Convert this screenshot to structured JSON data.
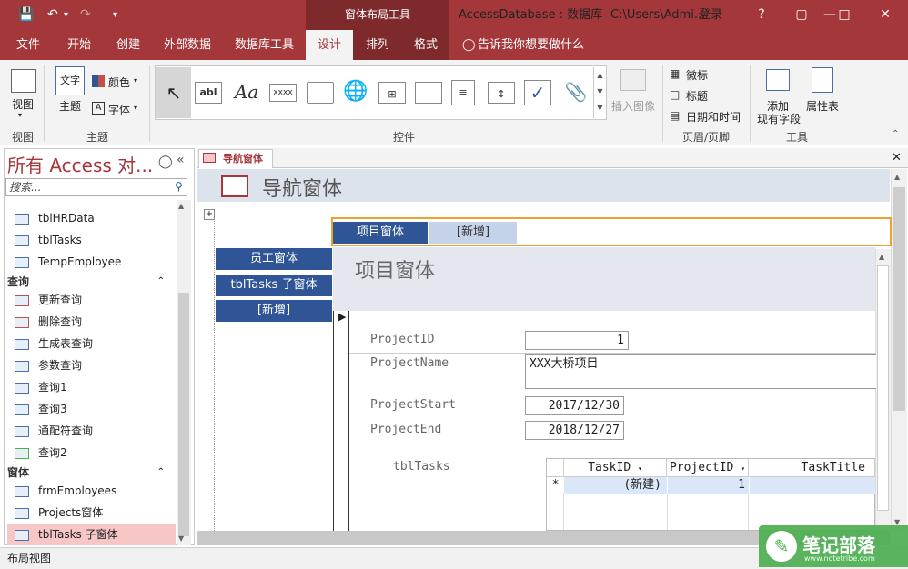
{
  "titlebar": {
    "context_tool": "窗体布局工具",
    "title": "AccessDatabase : 数据库- C:\\Users\\Admi...",
    "login": "登录",
    "help": "?"
  },
  "tabs": [
    "文件",
    "开始",
    "创建",
    "外部数据",
    "数据库工具",
    "设计",
    "排列",
    "格式"
  ],
  "tellme": "告诉我你想要做什么",
  "ribbon": {
    "view_label": "视图",
    "group_view": "视图",
    "theme_label": "主题",
    "colors_label": "颜色",
    "fonts_label": "字体",
    "group_theme": "主题",
    "group_controls": "控件",
    "insert_image": "插入图像",
    "logo": "徽标",
    "title": "标题",
    "datetime": "日期和时间",
    "group_header": "页眉/页脚",
    "add_fields": "添加",
    "add_fields2": "现有字段",
    "property_sheet": "属性表",
    "group_tools": "工具",
    "ctl_textbox": "abl",
    "ctl_label": "Aa",
    "ctl_button": "xxxx"
  },
  "nav": {
    "title": "所有 Access 对...",
    "search_placeholder": "搜索...",
    "tables": [
      "tblHRData",
      "tblTasks",
      "TempEmployee"
    ],
    "queries_header": "查询",
    "queries": [
      "更新查询",
      "删除查询",
      "生成表查询",
      "参数查询",
      "查询1",
      "查询3",
      "通配符查询",
      "查询2"
    ],
    "forms_header": "窗体",
    "forms": [
      "frmEmployees",
      "Projects窗体",
      "tblTasks 子窗体"
    ]
  },
  "doc": {
    "tab": "导航窗体",
    "form_title": "导航窗体",
    "nav_buttons": [
      "员工窗体",
      "tblTasks 子窗体",
      "[新增]"
    ],
    "sub_tabs": [
      "项目窗体",
      "[新增]"
    ],
    "sub_title": "项目窗体",
    "fields": [
      {
        "label": "ProjectID",
        "value": "1"
      },
      {
        "label": "ProjectName",
        "value": "XXX大桥项目"
      },
      {
        "label": "ProjectStart",
        "value": "2017/12/30"
      },
      {
        "label": "ProjectEnd",
        "value": "2018/12/27"
      }
    ],
    "subgrid_label": "tblTasks",
    "grid_headers": [
      "TaskID",
      "ProjectID",
      "TaskTitle"
    ],
    "grid_row": {
      "marker": "*",
      "taskid": "(新建)",
      "projectid": "1"
    }
  },
  "status": "布局视图",
  "watermark": {
    "text": "笔记部落",
    "url": "www.notetribe.com"
  }
}
